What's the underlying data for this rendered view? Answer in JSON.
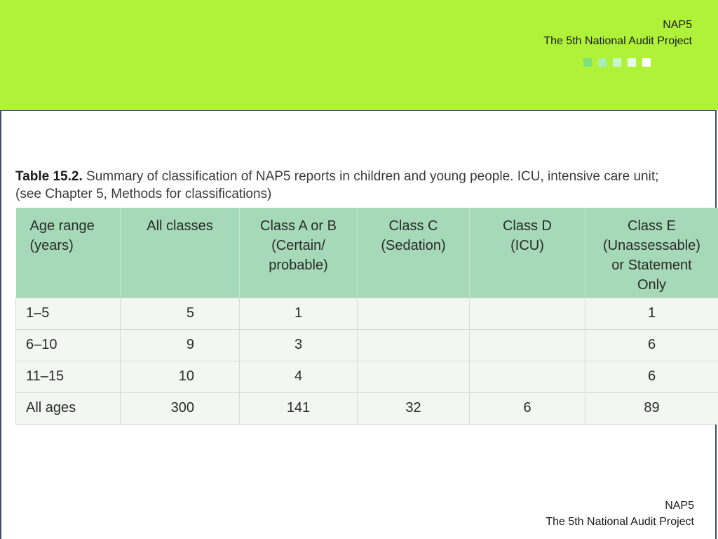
{
  "header": {
    "line1": "NAP5",
    "line2": "The 5th National Audit Project",
    "squares": [
      "#7ee27a",
      "#a8f0b0",
      "#c8f5cc",
      "#e6faea",
      "#ffffff"
    ]
  },
  "caption": {
    "label": "Table 15.2.",
    "line1": " Summary of classification of NAP5 reports in children and young people. ICU, intensive care unit;",
    "line2": "(see Chapter 5, Methods for classifications)"
  },
  "table": {
    "headers": [
      [
        "Age range",
        "(years)"
      ],
      [
        "All classes"
      ],
      [
        "Class A or B",
        "(Certain/",
        "probable)"
      ],
      [
        "Class C",
        "(Sedation)"
      ],
      [
        "Class D",
        "(ICU)"
      ],
      [
        "Class E",
        "(Unassessable)",
        "or Statement",
        "Only"
      ]
    ],
    "rows": [
      [
        "1–5",
        "5",
        "1",
        "",
        "",
        "1"
      ],
      [
        "6–10",
        "9",
        "3",
        "",
        "",
        "6"
      ],
      [
        "11–15",
        "10",
        "4",
        "",
        "",
        "6"
      ],
      [
        "All ages",
        "300",
        "141",
        "32",
        "6",
        "89"
      ]
    ]
  },
  "footer": {
    "line1": "NAP5",
    "line2": "The 5th National Audit Project"
  },
  "colors": {
    "header_band": "#b0f23a",
    "table_header": "#a5d9b8",
    "table_row": "#f3f7f2"
  }
}
